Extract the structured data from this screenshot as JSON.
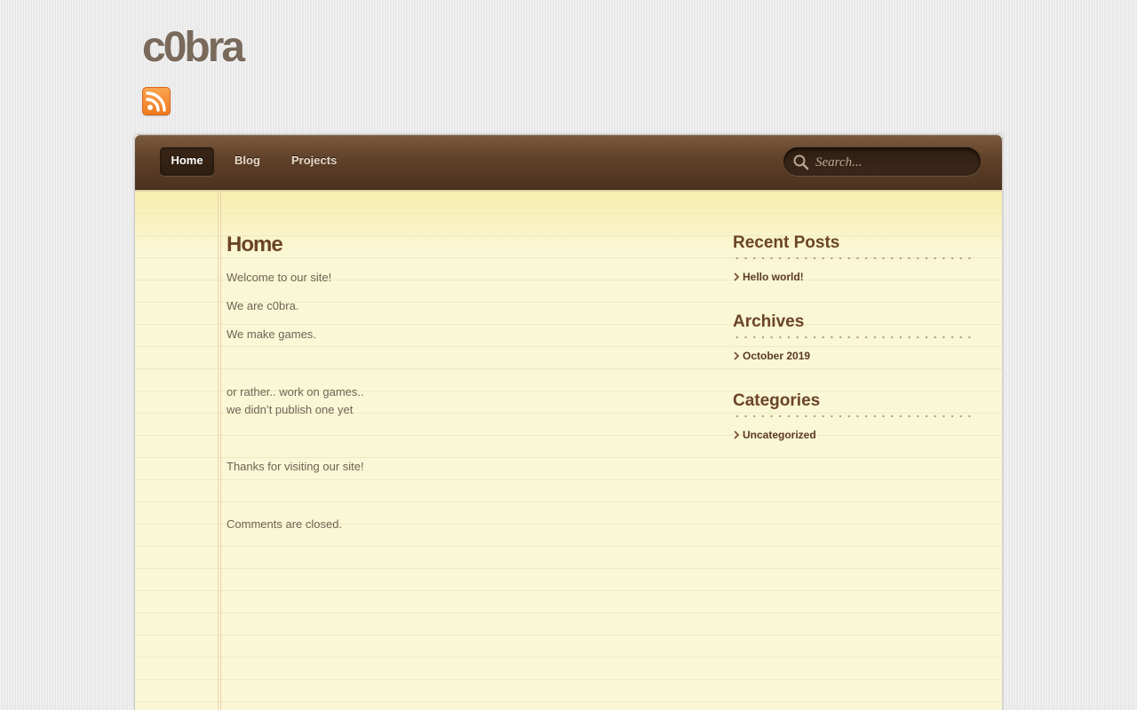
{
  "site": {
    "title": "c0bra",
    "rss_icon": "rss-icon"
  },
  "nav": {
    "items": [
      {
        "label": "Home",
        "active": true
      },
      {
        "label": "Blog",
        "active": false
      },
      {
        "label": "Projects",
        "active": false
      }
    ],
    "search_placeholder": "Search...",
    "search_value": "",
    "search_icon": "search-icon"
  },
  "main": {
    "title": "Home",
    "paragraphs": [
      "Welcome to our site!",
      "We are c0bra.",
      "We make games.",
      "or rather.. work on games..",
      "we didn’t publish one yet",
      "Thanks for visiting our site!"
    ],
    "comments_closed": "Comments are closed."
  },
  "sidebar": {
    "widgets": [
      {
        "title": "Recent Posts",
        "links": [
          "Hello world!"
        ]
      },
      {
        "title": "Archives",
        "links": [
          "October 2019"
        ]
      },
      {
        "title": "Categories",
        "links": [
          "Uncategorized"
        ]
      }
    ]
  },
  "colors": {
    "nav_bg": "#5f4029",
    "content_bg": "#faf7d6",
    "heading": "#6b4428",
    "body_text": "#6e6455",
    "rss_orange": "#f0781c"
  }
}
